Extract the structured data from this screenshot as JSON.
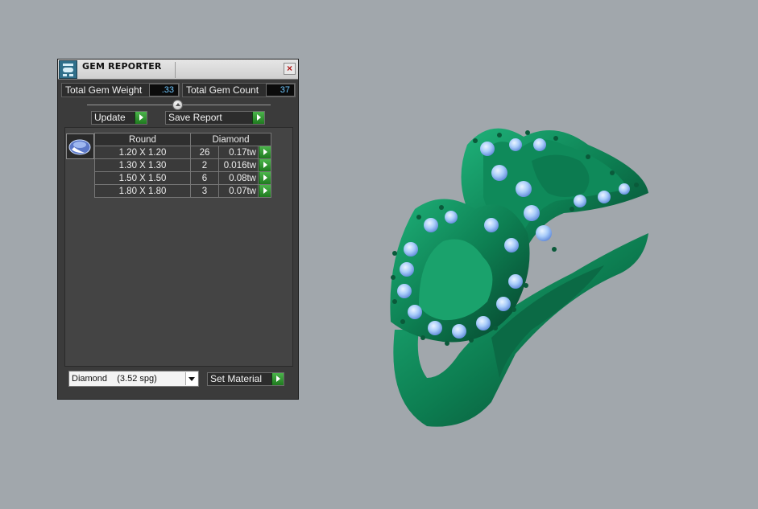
{
  "panel": {
    "title": "GEM REPORTER",
    "total_weight_label": "Total Gem Weight",
    "total_weight_value": ".33",
    "total_count_label": "Total Gem Count",
    "total_count_value": "37",
    "update_label": "Update",
    "save_report_label": "Save Report",
    "table": {
      "headers": [
        "Round",
        "Diamond"
      ],
      "rows": [
        {
          "size": "1.20 X 1.20",
          "count": "26",
          "weight": "0.17tw"
        },
        {
          "size": "1.30 X 1.30",
          "count": "2",
          "weight": "0.016tw"
        },
        {
          "size": "1.50 X 1.50",
          "count": "6",
          "weight": "0.08tw"
        },
        {
          "size": "1.80 X 1.80",
          "count": "3",
          "weight": "0.07tw"
        }
      ]
    },
    "material_select_value": "Diamond    (3.52 spg)",
    "set_material_label": "Set Material"
  },
  "icons": [
    "gem-reporter-app-icon",
    "close-icon",
    "slider-knob-icon",
    "play-arrow-icon",
    "round-gem-icon",
    "chevron-down-icon"
  ],
  "colors": {
    "background": "#a1a7ac",
    "panel": "#3b3b3b",
    "value_text": "#6ec7ff",
    "go_button": "#2e9a2e",
    "ring_metal": "#0e8a5a",
    "gem_blue": "#9fc7f7"
  }
}
